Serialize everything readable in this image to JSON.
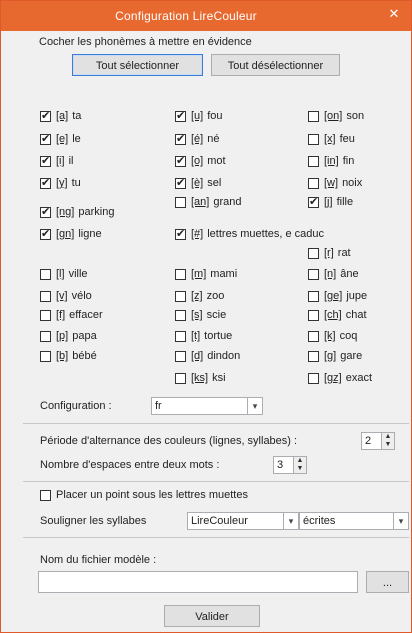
{
  "window": {
    "title": "Configuration LireCouleur",
    "close_glyph": "✕"
  },
  "instruction": "Cocher les phonèmes à mettre en évidence",
  "buttons": {
    "select_all": "Tout sélectionner",
    "deselect_all": "Tout désélectionner",
    "browse": "...",
    "validate": "Valider"
  },
  "phonemes": {
    "a": {
      "sym": "[a]",
      "label": "ta",
      "checked": true
    },
    "e": {
      "sym": "[e]",
      "label": "le",
      "checked": true
    },
    "i": {
      "sym": "[i]",
      "label": "il",
      "checked": true
    },
    "y": {
      "sym": "[y]",
      "label": "tu",
      "checked": true
    },
    "u": {
      "sym": "[u]",
      "label": "fou",
      "checked": true
    },
    "eacute": {
      "sym": "[é]",
      "label": "né",
      "checked": true
    },
    "o": {
      "sym": "[o]",
      "label": "mot",
      "checked": true
    },
    "egrave": {
      "sym": "[è]",
      "label": "sel",
      "checked": true
    },
    "an": {
      "sym": "[an]",
      "label": "grand",
      "checked": false
    },
    "on": {
      "sym": "[on]",
      "label": "son",
      "checked": false
    },
    "x": {
      "sym": "[x]",
      "label": "feu",
      "checked": false
    },
    "in": {
      "sym": "[in]",
      "label": "fin",
      "checked": false
    },
    "w": {
      "sym": "[w]",
      "label": "noix",
      "checked": false
    },
    "j": {
      "sym": "[j]",
      "label": "fille",
      "checked": true
    },
    "ng": {
      "sym": "[ng]",
      "label": "parking",
      "checked": true
    },
    "gn": {
      "sym": "[gn]",
      "label": "ligne",
      "checked": true
    },
    "muet": {
      "sym": "[#]",
      "label": "lettres muettes, e caduc",
      "checked": true
    },
    "r": {
      "sym": "[r]",
      "label": "rat",
      "checked": false
    },
    "l": {
      "sym": "[l]",
      "label": "ville",
      "checked": false
    },
    "m": {
      "sym": "[m]",
      "label": "mami",
      "checked": false
    },
    "n": {
      "sym": "[n]",
      "label": "âne",
      "checked": false
    },
    "v": {
      "sym": "[v]",
      "label": "vélo",
      "checked": false
    },
    "z": {
      "sym": "[z]",
      "label": "zoo",
      "checked": false
    },
    "ge": {
      "sym": "[ge]",
      "label": "jupe",
      "checked": false
    },
    "f": {
      "sym": "[f]",
      "label": "effacer",
      "checked": false
    },
    "s": {
      "sym": "[s]",
      "label": "scie",
      "checked": false
    },
    "ch": {
      "sym": "[ch]",
      "label": "chat",
      "checked": false
    },
    "p": {
      "sym": "[p]",
      "label": "papa",
      "checked": false
    },
    "t": {
      "sym": "[t]",
      "label": "tortue",
      "checked": false
    },
    "k": {
      "sym": "[k]",
      "label": "coq",
      "checked": false
    },
    "b": {
      "sym": "[b]",
      "label": "bébé",
      "checked": false
    },
    "d": {
      "sym": "[d]",
      "label": "dindon",
      "checked": false
    },
    "g": {
      "sym": "[g]",
      "label": "gare",
      "checked": false
    },
    "ks": {
      "sym": "[ks]",
      "label": "ksi",
      "checked": false
    },
    "gz": {
      "sym": "[gz]",
      "label": "exact",
      "checked": false
    }
  },
  "configuration": {
    "label": "Configuration :",
    "value": "fr"
  },
  "alternance": {
    "label": "Période d'alternance des couleurs (lignes, syllabes) :",
    "value": "2"
  },
  "espaces": {
    "label": "Nombre d'espaces entre deux mots :",
    "value": "3"
  },
  "point_muettes": {
    "label": "Placer un point sous les lettres muettes",
    "checked": false
  },
  "syllabes": {
    "label": "Souligner les syllabes",
    "mode": "LireCouleur",
    "type": "écrites"
  },
  "modele": {
    "label": "Nom du fichier modèle :",
    "value": ""
  }
}
